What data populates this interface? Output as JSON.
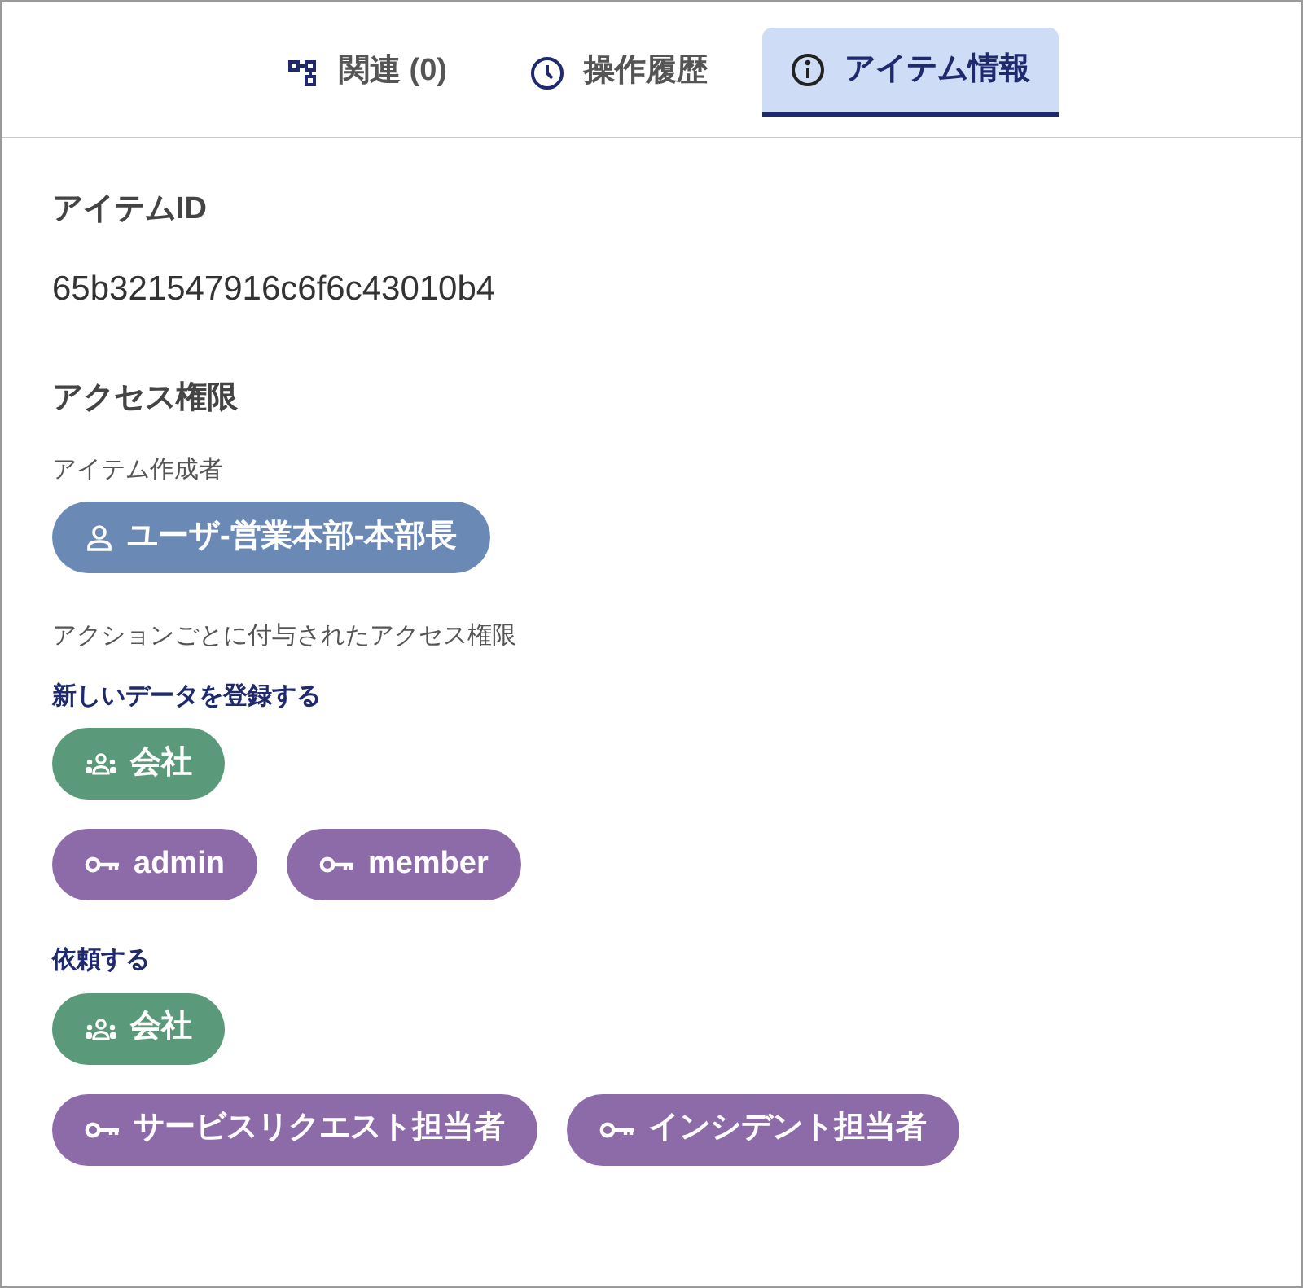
{
  "tabs": [
    {
      "label": "関連 (0)",
      "kind": "relations",
      "selected": false
    },
    {
      "label": "操作履歴",
      "kind": "history",
      "selected": false
    },
    {
      "label": "アイテム情報",
      "kind": "info",
      "selected": true
    }
  ],
  "item_id": {
    "heading": "アイテムID",
    "value": "65b321547916c6f6c43010b4"
  },
  "access": {
    "heading": "アクセス権限",
    "creator_label": "アイテム作成者",
    "creator": {
      "kind": "user",
      "label": "ユーザ-営業本部-本部長"
    },
    "actions_label": "アクションごとに付与されたアクセス権限",
    "actions": [
      {
        "title": "新しいデータを登録する",
        "rows": [
          [
            {
              "kind": "group",
              "label": "会社"
            }
          ],
          [
            {
              "kind": "role",
              "label": "admin"
            },
            {
              "kind": "role",
              "label": "member"
            }
          ]
        ]
      },
      {
        "title": "依頼する",
        "rows": [
          [
            {
              "kind": "group",
              "label": "会社"
            }
          ],
          [
            {
              "kind": "role",
              "label": "サービスリクエスト担当者"
            },
            {
              "kind": "role",
              "label": "インシデント担当者"
            }
          ]
        ]
      }
    ]
  }
}
